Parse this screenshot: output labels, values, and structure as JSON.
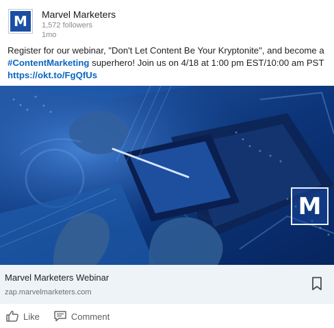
{
  "post": {
    "company_name": "Marvel Marketers",
    "followers": "1,572 followers",
    "age": "1mo",
    "logo_letter": "M",
    "text_prefix": "Register for our webinar, \"Don't Let Content Be Your Kryptonite\", and become a ",
    "hashtag": "#ContentMarketing",
    "text_suffix": " superhero! Join us on 4/18 at 1:00 pm EST/10:00 am PST",
    "url": "https://okt.to/FgQfUs"
  },
  "media": {
    "logo_letter": "M"
  },
  "link_card": {
    "title": "Marvel Marketers Webinar",
    "domain": "zap.marvelmarketers.com"
  },
  "actions": {
    "like": "Like",
    "comment": "Comment"
  },
  "colors": {
    "brand_blue": "#1a4fa3",
    "link_blue": "#0a66c2",
    "image_base": "#0d2f6a",
    "card_background": "#eef3f8"
  },
  "icons": [
    "company-logo",
    "bookmark-icon",
    "like-icon",
    "comment-icon"
  ]
}
